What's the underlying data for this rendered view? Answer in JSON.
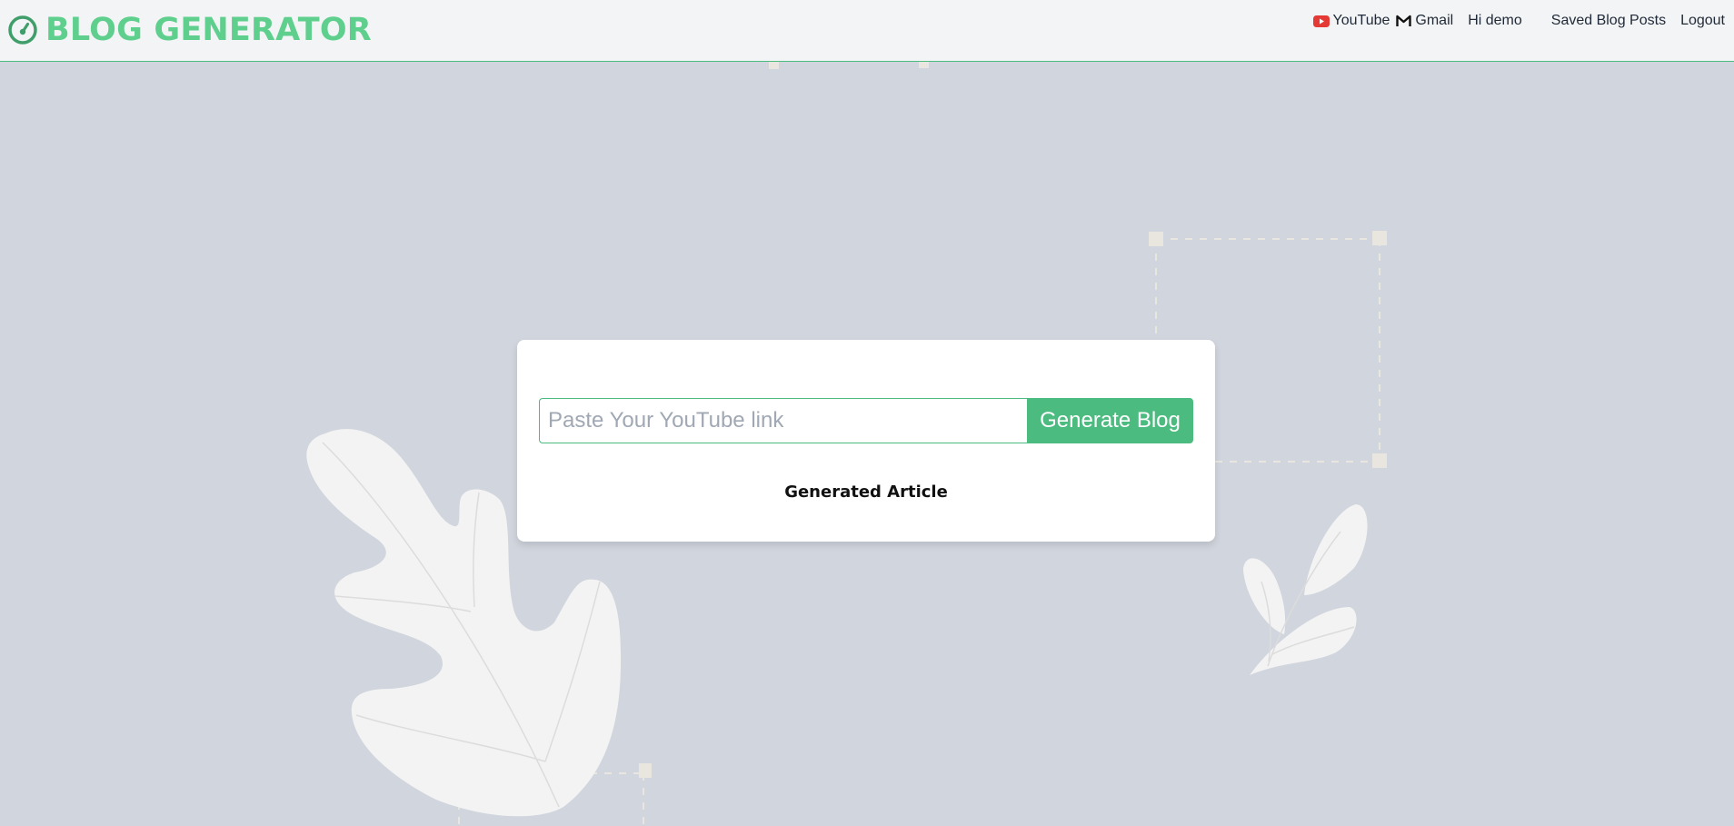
{
  "header": {
    "brand_title": "BLOG GENERATOR",
    "brand_icon": "gauge-icon",
    "nav": {
      "youtube_label": "YouTube",
      "gmail_label": "Gmail",
      "greeting": "Hi demo",
      "saved_posts_label": "Saved Blog Posts",
      "logout_label": "Logout"
    }
  },
  "main": {
    "input_placeholder": "Paste Your YouTube link",
    "input_value": "",
    "generate_label": "Generate Blog",
    "article_heading": "Generated Article"
  },
  "colors": {
    "accent": "#4cbb7f",
    "brand_text": "#5fcf8e",
    "background": "#d1d5dd",
    "header_bg": "#f3f4f6",
    "youtube_red": "#e53935"
  }
}
